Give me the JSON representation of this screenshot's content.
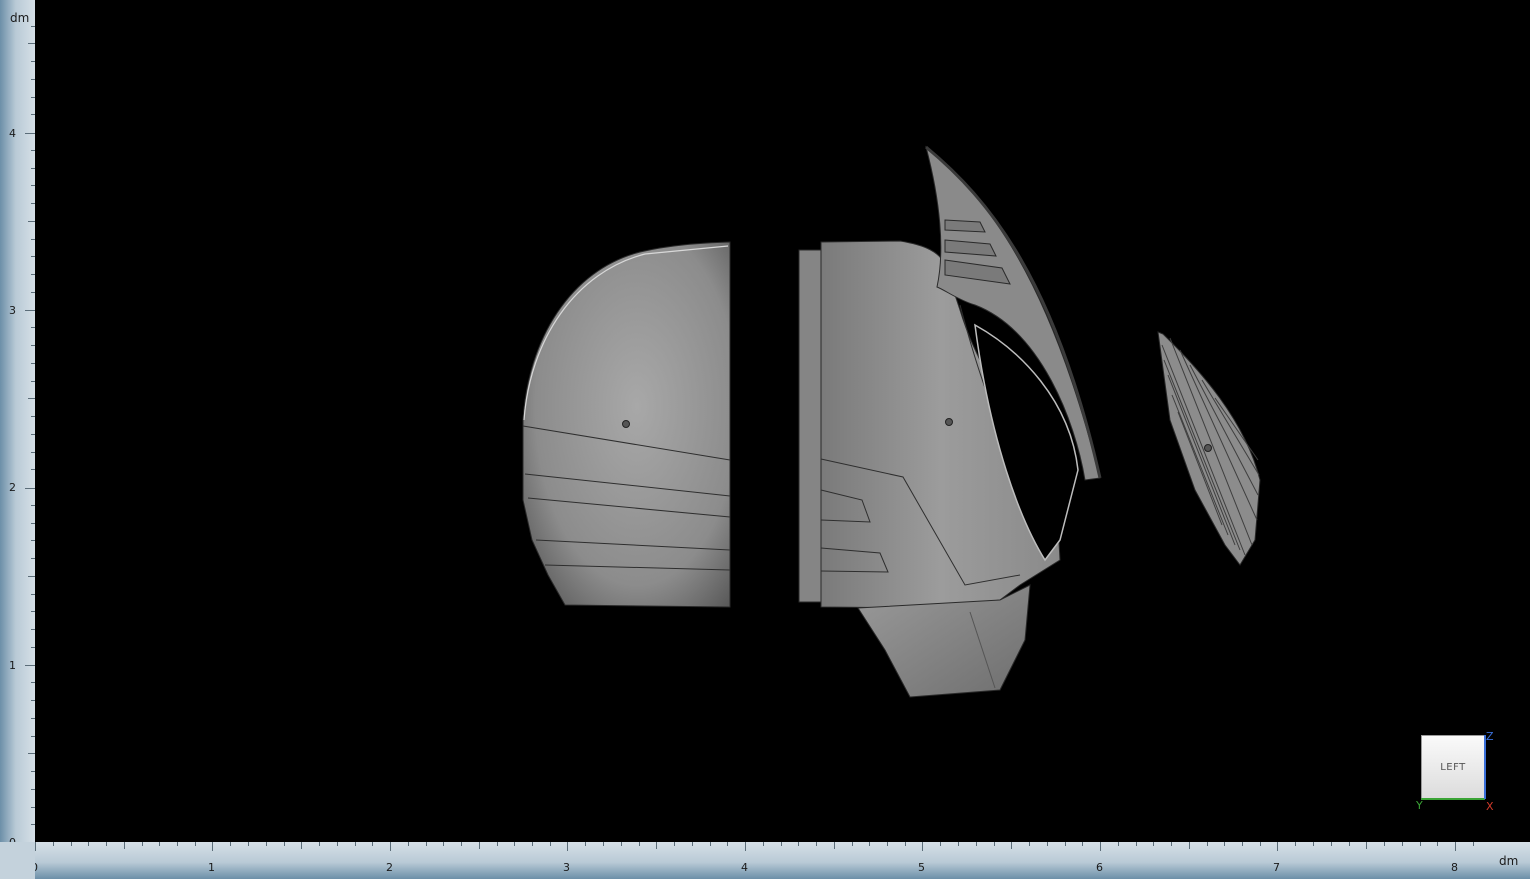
{
  "rulers": {
    "unit_left": "dm",
    "unit_bottom": "dm",
    "left_labels": [
      "4",
      "3",
      "2",
      "1",
      "0"
    ],
    "bottom_labels": [
      "0",
      "1",
      "2",
      "3",
      "4",
      "5",
      "6",
      "7",
      "8"
    ]
  },
  "view_cube": {
    "face_label": "LEFT",
    "axis_z": "Z",
    "axis_y": "Y",
    "axis_x": "X"
  },
  "colors": {
    "background": "#000000",
    "model_gray": "#8f8f8f",
    "ruler": "#b9cad6",
    "axis_z": "#3a6fd8",
    "axis_y": "#3aa335",
    "axis_x": "#d03a2a"
  }
}
